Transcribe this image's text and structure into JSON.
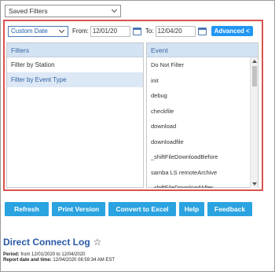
{
  "saved_filters": {
    "label": "Saved Filters"
  },
  "date_filter": {
    "type_value": "Custom Date",
    "from_label": "From:",
    "from_value": "12/01/20",
    "to_label": "To:",
    "to_value": "12/04/20",
    "advanced_label": "Advanced <"
  },
  "filters": {
    "header": "Filters",
    "items": [
      "Filter by Station",
      "Filter by Event Type"
    ]
  },
  "events": {
    "header": "Event",
    "items": [
      "Do Not Filter",
      "init",
      "debug",
      "checkfile",
      "download",
      "downloadfile",
      "_shiftFileDownloadBefore",
      "samba LS remoteArchive",
      "_shiftFileDownloadAfter"
    ]
  },
  "toolbar": {
    "refresh": "Refresh",
    "print": "Print Version",
    "excel": "Convert to Excel",
    "help": "Help",
    "feedback": "Feedback"
  },
  "report": {
    "title": "Direct Connect Log",
    "period_label": "Period:",
    "period_value": "from 12/01/2020 to 12/04/2020",
    "report_label": "Report date and time:",
    "report_value": "12/04/2020 08:59:34 AM EST"
  }
}
